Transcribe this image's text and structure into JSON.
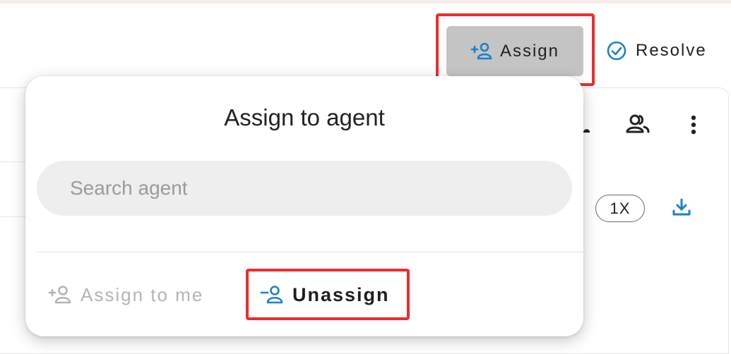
{
  "toolbar": {
    "assign_label": "Assign",
    "resolve_label": "Resolve"
  },
  "conversation": {
    "playback_speed": "1X"
  },
  "assign_popup": {
    "title": "Assign to agent",
    "search_placeholder": "Search agent",
    "assign_to_me_label": "Assign to me",
    "unassign_label": "Unassign"
  },
  "colors": {
    "accent_blue": "#1e7fc9",
    "highlight_red": "#f02a2e",
    "assign_button_bg": "#c4c4c4",
    "search_bg": "#eeeeee",
    "disabled_text": "#b4b4b4"
  },
  "icons": {
    "assign": "person-add-icon",
    "resolve": "check-circle-icon",
    "participants": "people-icon",
    "more": "more-vertical-icon",
    "download": "download-icon",
    "assign_to_me": "person-add-icon",
    "unassign": "person-remove-icon"
  }
}
